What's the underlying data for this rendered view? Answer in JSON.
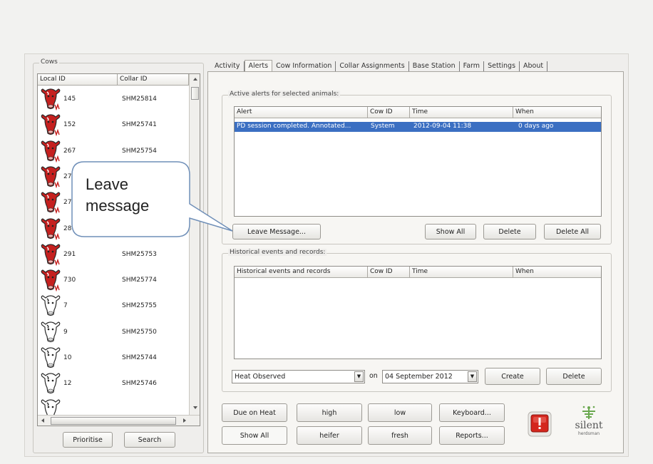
{
  "tabs": [
    "Activity",
    "Alerts",
    "Cow Information",
    "Collar Assignments",
    "Base Station",
    "Farm",
    "Settings",
    "About"
  ],
  "active_tab": "Alerts",
  "cows_panel": {
    "title": "Cows",
    "columns": [
      "Local ID",
      "Collar ID"
    ],
    "rows": [
      {
        "local_id": "145",
        "collar_id": "SHM25814",
        "alert": true
      },
      {
        "local_id": "152",
        "collar_id": "SHM25741",
        "alert": true
      },
      {
        "local_id": "267",
        "collar_id": "SHM25754",
        "alert": true
      },
      {
        "local_id": "270",
        "collar_id": "",
        "alert": true
      },
      {
        "local_id": "271",
        "collar_id": "",
        "alert": true
      },
      {
        "local_id": "289",
        "collar_id": "",
        "alert": true
      },
      {
        "local_id": "291",
        "collar_id": "SHM25753",
        "alert": true
      },
      {
        "local_id": "730",
        "collar_id": "SHM25774",
        "alert": true
      },
      {
        "local_id": "7",
        "collar_id": "SHM25755",
        "alert": false
      },
      {
        "local_id": "9",
        "collar_id": "SHM25750",
        "alert": false
      },
      {
        "local_id": "10",
        "collar_id": "SHM25744",
        "alert": false
      },
      {
        "local_id": "12",
        "collar_id": "SHM25746",
        "alert": false
      },
      {
        "local_id": "",
        "collar_id": "",
        "alert": false
      }
    ],
    "prioritise_label": "Prioritise",
    "search_label": "Search"
  },
  "active_alerts": {
    "title": "Active alerts for selected animals:",
    "columns": [
      "Alert",
      "Cow ID",
      "Time",
      "When"
    ],
    "rows": [
      {
        "alert": "PD session completed. Annotated...",
        "cow_id": "System",
        "time": "2012-09-04 11:38",
        "when": "0 days ago"
      }
    ],
    "leave_message_label": "Leave Message...",
    "show_all_label": "Show All",
    "delete_label": "Delete",
    "delete_all_label": "Delete All"
  },
  "historical": {
    "title": "Historical events and records:",
    "columns": [
      "Historical events and records",
      "Cow ID",
      "Time",
      "When"
    ],
    "event_type": "Heat Observed",
    "on_label": "on",
    "date": "04 September 2012",
    "create_label": "Create",
    "delete_label": "Delete"
  },
  "filters": {
    "row1": [
      "Due on Heat",
      "high",
      "low",
      "Keyboard..."
    ],
    "row2": [
      "Show All",
      "heifer",
      "fresh",
      "Reports..."
    ]
  },
  "callout": {
    "line1": "Leave",
    "line2": "message"
  },
  "logo": {
    "text": "silent",
    "subtext": "herdsman"
  },
  "colors": {
    "selection": "#3b6fc2",
    "cow_red": "#c5201f",
    "alarm_red": "#d4261d",
    "logo_green": "#6aa84f"
  }
}
